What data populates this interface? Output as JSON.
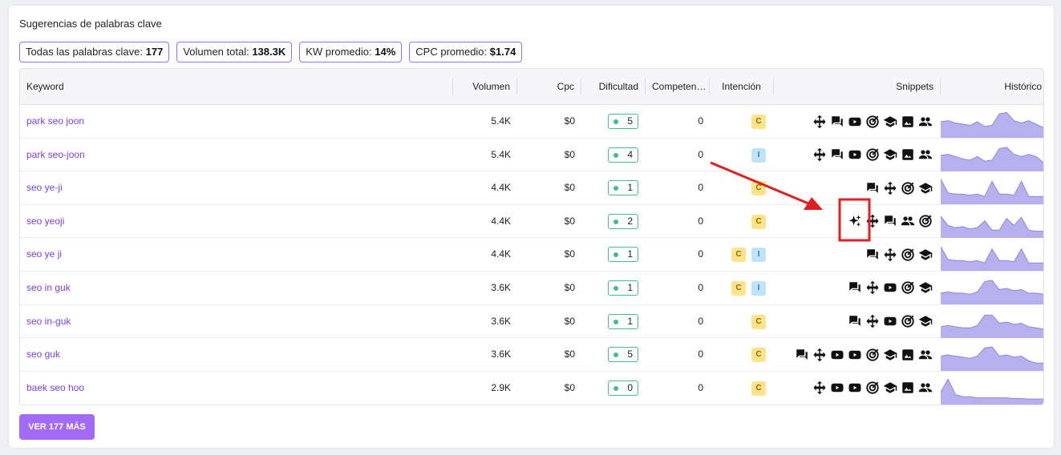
{
  "title": "Sugerencias de palabras clave",
  "stats": [
    {
      "label": "Todas las palabras clave:",
      "value": "177"
    },
    {
      "label": "Volumen total:",
      "value": "138.3K"
    },
    {
      "label": "KW promedio:",
      "value": "14%"
    },
    {
      "label": "CPC promedio:",
      "value": "$1.74"
    }
  ],
  "columns": {
    "keyword": "Keyword",
    "volume": "Volumen",
    "cpc": "Cpc",
    "difficulty": "Dificultad",
    "competition": "Competen…",
    "intent": "Intención",
    "snippets": "Snippets",
    "history": "Histórico"
  },
  "rows": [
    {
      "keyword": "park seo joon",
      "volume": "5.4K",
      "cpc": "$0",
      "difficulty": "5",
      "competition": "0",
      "intent": [
        "C"
      ],
      "snippets": [
        "move",
        "chat",
        "video",
        "target",
        "school",
        "image",
        "people"
      ],
      "trend": [
        0.55,
        0.6,
        0.5,
        0.45,
        0.4,
        0.55,
        0.35,
        0.4,
        0.9,
        0.95,
        0.6,
        0.5,
        0.6,
        0.45,
        0.3
      ]
    },
    {
      "keyword": "park seo-joon",
      "volume": "5.4K",
      "cpc": "$0",
      "difficulty": "4",
      "competition": "0",
      "intent": [
        "I"
      ],
      "snippets": [
        "move",
        "chat",
        "video",
        "target",
        "school",
        "image",
        "people"
      ],
      "trend": [
        0.55,
        0.6,
        0.5,
        0.4,
        0.35,
        0.5,
        0.3,
        0.35,
        0.85,
        0.9,
        0.6,
        0.5,
        0.6,
        0.5,
        0.25
      ]
    },
    {
      "keyword": "seo ye-ji",
      "volume": "4.4K",
      "cpc": "$0",
      "difficulty": "1",
      "competition": "0",
      "intent": [
        "C"
      ],
      "snippets": [
        "chat",
        "move",
        "target",
        "school"
      ],
      "trend": [
        0.95,
        0.35,
        0.3,
        0.3,
        0.25,
        0.3,
        0.2,
        0.85,
        0.3,
        0.3,
        0.25,
        0.85,
        0.2,
        0.2,
        0.2
      ]
    },
    {
      "keyword": "seo yeoji",
      "volume": "4.4K",
      "cpc": "$0",
      "difficulty": "2",
      "competition": "0",
      "intent": [
        "C"
      ],
      "snippets": [
        "sparkle",
        "move",
        "chat",
        "people",
        "target"
      ],
      "trend": [
        0.8,
        0.4,
        0.3,
        0.35,
        0.25,
        0.3,
        0.6,
        0.2,
        0.2,
        0.7,
        0.4,
        0.75,
        0.2,
        0.15,
        0.15
      ]
    },
    {
      "keyword": "seo ye ji",
      "volume": "4.4K",
      "cpc": "$0",
      "difficulty": "1",
      "competition": "0",
      "intent": [
        "C",
        "I"
      ],
      "snippets": [
        "chat",
        "move",
        "target",
        "school"
      ],
      "trend": [
        0.9,
        0.35,
        0.3,
        0.3,
        0.25,
        0.3,
        0.2,
        0.8,
        0.3,
        0.3,
        0.25,
        0.8,
        0.2,
        0.2,
        0.2
      ]
    },
    {
      "keyword": "seo in guk",
      "volume": "3.6K",
      "cpc": "$0",
      "difficulty": "1",
      "competition": "0",
      "intent": [
        "C",
        "I"
      ],
      "snippets": [
        "chat",
        "move",
        "video",
        "target",
        "school"
      ],
      "trend": [
        0.35,
        0.4,
        0.35,
        0.35,
        0.3,
        0.4,
        0.85,
        0.9,
        0.5,
        0.55,
        0.45,
        0.5,
        0.35,
        0.35,
        0.3
      ]
    },
    {
      "keyword": "seo in-guk",
      "volume": "3.6K",
      "cpc": "$0",
      "difficulty": "1",
      "competition": "0",
      "intent": [
        "C"
      ],
      "snippets": [
        "chat",
        "move",
        "video",
        "target",
        "school"
      ],
      "trend": [
        0.35,
        0.4,
        0.35,
        0.3,
        0.3,
        0.4,
        0.85,
        0.85,
        0.5,
        0.55,
        0.45,
        0.5,
        0.35,
        0.3,
        0.25
      ]
    },
    {
      "keyword": "seo guk",
      "volume": "3.6K",
      "cpc": "$0",
      "difficulty": "5",
      "competition": "0",
      "intent": [
        "C"
      ],
      "snippets": [
        "chat",
        "move",
        "video",
        "video",
        "target",
        "school",
        "image",
        "people"
      ],
      "trend": [
        0.5,
        0.55,
        0.5,
        0.45,
        0.4,
        0.5,
        0.85,
        0.9,
        0.5,
        0.55,
        0.45,
        0.5,
        0.3,
        0.2,
        0.2
      ]
    },
    {
      "keyword": "baek seo hoo",
      "volume": "2.9K",
      "cpc": "$0",
      "difficulty": "0",
      "competition": "0",
      "intent": [
        "C"
      ],
      "snippets": [
        "move",
        "video",
        "video",
        "target",
        "school",
        "image",
        "people"
      ],
      "trend": [
        0.4,
        0.95,
        0.3,
        0.2,
        0.2,
        0.15,
        0.15,
        0.15,
        0.15,
        0.15,
        0.12,
        0.12,
        0.1,
        0.1,
        0.1
      ]
    }
  ],
  "more_button": "VER 177 MÁS",
  "colors": {
    "accent": "#a36af5",
    "keyword": "#7b3fe4",
    "spark_fill": "#b7b0ee",
    "spark_line": "#8f86e0",
    "annotation": "#e02020"
  }
}
